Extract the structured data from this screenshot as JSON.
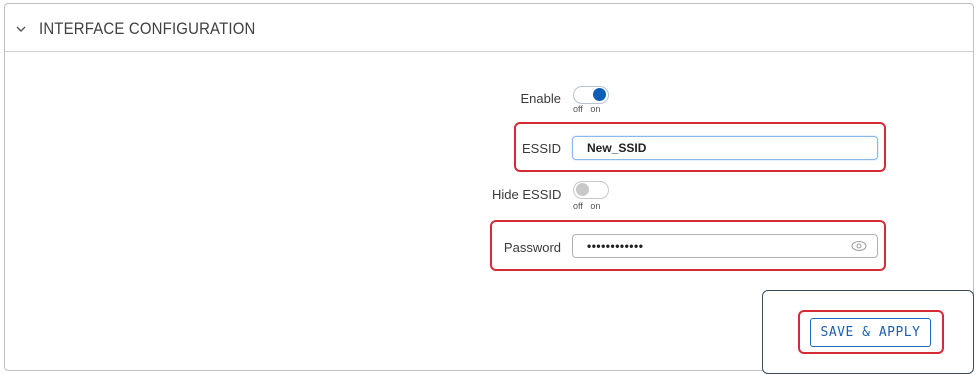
{
  "section": {
    "title": "INTERFACE CONFIGURATION"
  },
  "fields": {
    "enable": {
      "label": "Enable",
      "state": "on",
      "off_text": "off",
      "on_text": "on"
    },
    "essid": {
      "label": "ESSID",
      "value": "New_SSID"
    },
    "hide_essid": {
      "label": "Hide ESSID",
      "state": "off",
      "off_text": "off",
      "on_text": "on"
    },
    "password": {
      "label": "Password",
      "value": "••••••••••••"
    }
  },
  "actions": {
    "save_apply_label": "SAVE & APPLY"
  },
  "colors": {
    "toggle_on": "#0d5fb6",
    "highlight": "#d52b36",
    "button_accent": "#1c69c4"
  },
  "icons": [
    "chevron-down-icon",
    "eye-icon"
  ]
}
